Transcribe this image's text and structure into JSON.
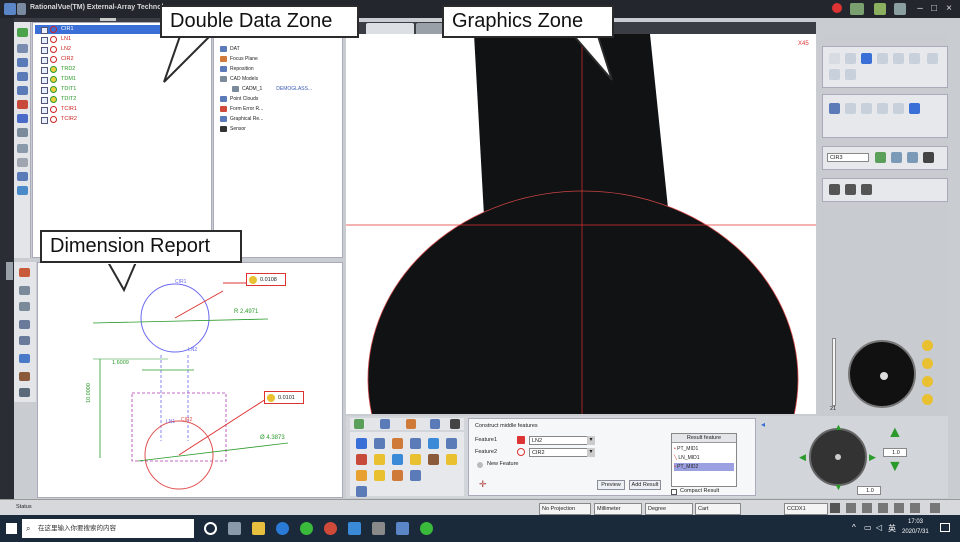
{
  "app": {
    "title": "RationalVue(TM) External-Array Technology",
    "accent": "#3a6fd8"
  },
  "tree": {
    "items": [
      {
        "label": "CIR1",
        "color": "#cc2222",
        "icon": "circle-icon",
        "selected": true
      },
      {
        "label": "LN1",
        "color": "#cc2222",
        "icon": "line-icon"
      },
      {
        "label": "LN2",
        "color": "#cc2222",
        "icon": "line-icon"
      },
      {
        "label": "CIR2",
        "color": "#cc2222",
        "icon": "circle-icon"
      },
      {
        "label": "TRD2",
        "color": "#2a9a2a",
        "icon": "dimension-icon"
      },
      {
        "label": "TDM1",
        "color": "#2a9a2a",
        "icon": "dimension-icon"
      },
      {
        "label": "TDIT1",
        "color": "#2a9a2a",
        "icon": "dimension-icon"
      },
      {
        "label": "TDIT2",
        "color": "#2a9a2a",
        "icon": "dimension-icon"
      },
      {
        "label": "TCIR1",
        "color": "#cc2222",
        "icon": "circle-icon"
      },
      {
        "label": "TCIR2",
        "color": "#cc2222",
        "icon": "circle-icon"
      }
    ]
  },
  "props": {
    "items": [
      {
        "label": "DAT",
        "indent": 0
      },
      {
        "label": "Focus Plane",
        "indent": 0
      },
      {
        "label": "Reposition",
        "indent": 0
      },
      {
        "label": "CAD Models",
        "indent": 0
      },
      {
        "label": "CADM_1",
        "indent": 1,
        "value": "DEMOGLASS..."
      },
      {
        "label": "Point Clouds",
        "indent": 0
      },
      {
        "label": "Form Error R...",
        "indent": 0
      },
      {
        "label": "Graphical Re...",
        "indent": 0
      },
      {
        "label": "Sensor",
        "indent": 0
      }
    ]
  },
  "dimension_report": {
    "cir_label": "CIR1",
    "ln2_label": "LN2",
    "ln1_label": "LN1",
    "cir2_label": "CIR2",
    "radius": "R 2.4971",
    "dist_h": "1.6009",
    "dist_v": "10.0000",
    "diameter": "Ø 4.3873",
    "tol1": "0.0108",
    "tol2": "0.0101"
  },
  "graphics": {
    "tabs": [
      "",
      ""
    ],
    "zoom": "X45"
  },
  "right": {
    "feature_name": "CIR3",
    "slider_value": "21"
  },
  "wizard": {
    "title": "Construct middle features",
    "feature1_label": "Feature1",
    "feature1_value": "LN2",
    "feature2_label": "Feature2",
    "feature2_value": "CIR2",
    "new_feature": "New Feature",
    "preview": "Preview",
    "add_result": "Add Result",
    "result_header": "Result feature",
    "results": [
      "PT_MID1",
      "LN_MID1",
      "PT_MID2"
    ],
    "compact": "Compact Result"
  },
  "control": {
    "step1": "1.0",
    "step2": "1.0"
  },
  "status": {
    "label": "Status",
    "projection": "No Projection",
    "unit": "Millimeter",
    "angle": "Degree",
    "coord": "Cart",
    "ccd": "CCDX1"
  },
  "taskbar": {
    "search_placeholder": "在这里输入你要搜索的内容",
    "time": "17:03",
    "date": "2020/7/31",
    "lang": "英"
  },
  "callouts": {
    "double_data": "Double Data Zone",
    "graphics": "Graphics Zone",
    "dimension": "Dimension Report"
  }
}
